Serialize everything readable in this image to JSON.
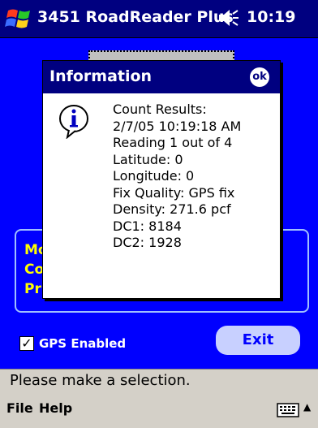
{
  "titlebar": {
    "title": "3451 RoadReader Plus",
    "clock": "10:19"
  },
  "main": {
    "group_labels": [
      "Mo",
      "Co",
      "Pr"
    ],
    "gps_label": "GPS Enabled",
    "gps_checked": true,
    "exit_label": "Exit"
  },
  "dialog": {
    "title": "Information",
    "ok_label": "ok",
    "lines": [
      "Count Results:",
      "2/7/05 10:19:18 AM",
      "Reading 1 out of 4",
      "Latitude: 0",
      "Longitude: 0",
      "Fix Quality: GPS fix",
      "Density: 271.6 pcf",
      "DC1: 8184",
      "DC2: 1928"
    ]
  },
  "status": {
    "text": "Please make a selection."
  },
  "menu": {
    "file": "File",
    "help": "Help"
  },
  "colors": {
    "background": "#0000ff",
    "titlebar": "#000080",
    "label_yellow": "#ffff00",
    "exit_button": "#c8d0ff"
  },
  "icons": [
    "windows-start-icon",
    "speaker-icon",
    "info-icon",
    "keyboard-icon"
  ]
}
